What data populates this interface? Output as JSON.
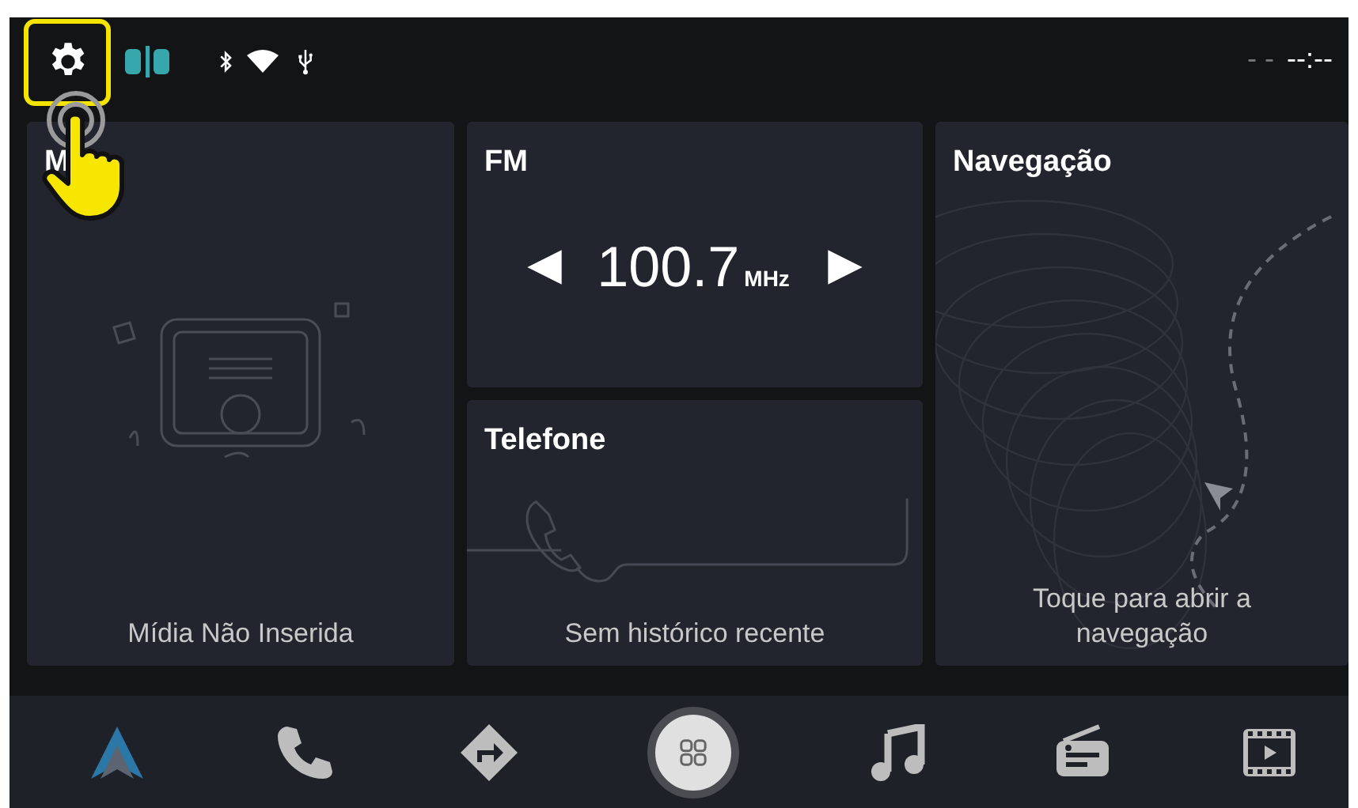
{
  "status_bar": {
    "settings_highlighted": true,
    "date": "- -",
    "time": "--:--"
  },
  "cards": [
    {
      "kind": "media",
      "title": "M",
      "caption": "Mídia Não Inserida"
    },
    {
      "kind": "radio",
      "title": "FM",
      "frequency": "100.7",
      "unit": "MHz"
    },
    {
      "kind": "phone",
      "title": "Telefone",
      "caption": "Sem histórico recente"
    },
    {
      "kind": "nav",
      "title": "Navegação",
      "caption": "Toque para abrir a navegação"
    }
  ],
  "dock": [
    {
      "kind": "launcher"
    },
    {
      "kind": "phone"
    },
    {
      "kind": "directions"
    },
    {
      "kind": "apps"
    },
    {
      "kind": "music"
    },
    {
      "kind": "radio"
    },
    {
      "kind": "video"
    }
  ]
}
